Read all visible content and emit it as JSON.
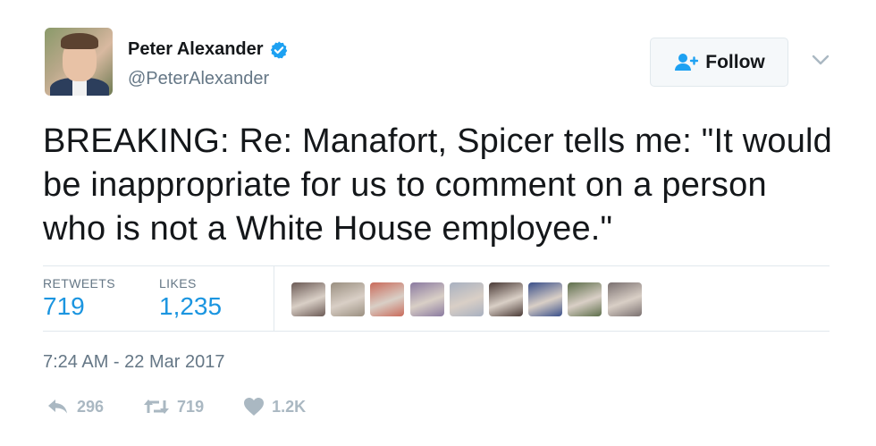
{
  "author": {
    "display_name": "Peter Alexander",
    "handle": "@PeterAlexander",
    "verified": true
  },
  "follow_button": {
    "label": "Follow"
  },
  "tweet": {
    "text": "BREAKING: Re: Manafort, Spicer tells me: \"It would be inappropriate for us to comment on a person who is not a White House employee.\""
  },
  "stats": {
    "retweets_label": "RETWEETS",
    "retweets_count": "719",
    "likes_label": "LIKES",
    "likes_count": "1,235"
  },
  "likers": [
    {
      "color": "#6b5a55"
    },
    {
      "color": "#9a8f80"
    },
    {
      "color": "#c96a5a"
    },
    {
      "color": "#8a7aa0"
    },
    {
      "color": "#a8b0c0"
    },
    {
      "color": "#4a3a36"
    },
    {
      "color": "#3a4f8a"
    },
    {
      "color": "#5d6e4a"
    },
    {
      "color": "#7a7070"
    }
  ],
  "timestamp": "7:24 AM - 22 Mar 2017",
  "actions": {
    "reply_count": "296",
    "retweet_count": "719",
    "like_count": "1.2K"
  },
  "colors": {
    "link_blue": "#1b95e0",
    "muted_gray": "#657786",
    "icon_gray": "#aab8c2"
  }
}
